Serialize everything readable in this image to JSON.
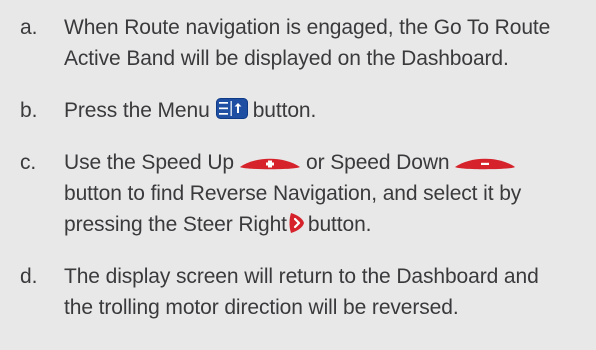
{
  "steps": [
    {
      "marker": "a.",
      "line1": "When Route navigation is engaged, the Go To Route",
      "line2": "Active Band will be displayed on the Dashboard."
    },
    {
      "marker": "b.",
      "text_before_icon": "Press the Menu",
      "icon": "menu-button-icon",
      "text_after_icon": "button."
    },
    {
      "marker": "c.",
      "line1_before_up": "Use the Speed Up",
      "up_icon": "speed-up-button-icon",
      "line1_between": "or Speed Down",
      "down_icon": "speed-down-button-icon",
      "line2": "button to find Reverse Navigation, and select it by",
      "line3_before_icon": "pressing the Steer Right",
      "steer_icon": "steer-right-button-icon",
      "line3_after_icon": "button."
    },
    {
      "marker": "d.",
      "line1": "The display screen will return to the Dashboard and",
      "line2": "the trolling motor direction will be reversed."
    }
  ],
  "colors": {
    "background": "#e8e8e9",
    "text": "#3a3a3c",
    "menu_icon_blue": "#1f4fa3",
    "button_red": "#d6232b"
  }
}
